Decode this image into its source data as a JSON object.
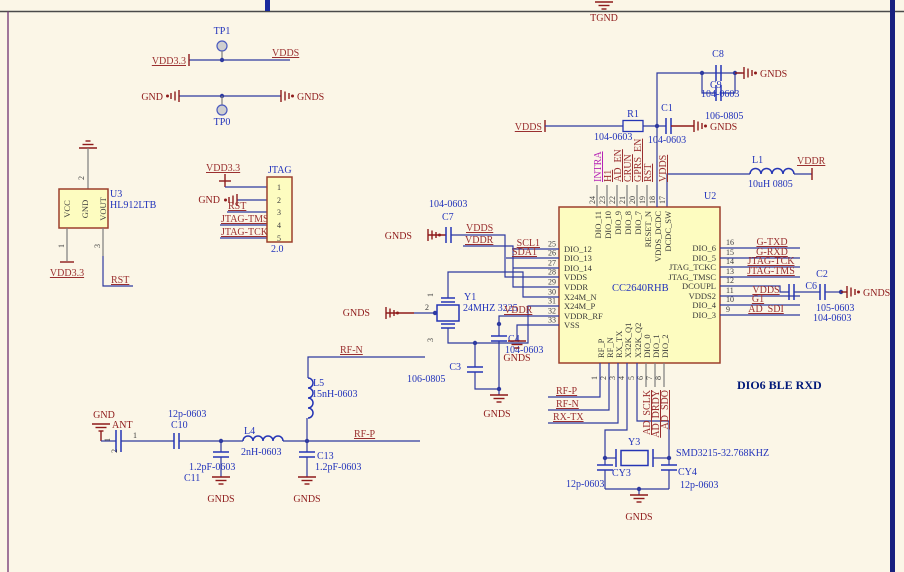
{
  "sheet": {
    "tgnd": "TGND"
  },
  "tp": {
    "tp1": "TP1",
    "tp0": "TP0",
    "vdd33": "VDD3.3",
    "vdds": "VDDS",
    "gnd": "GND",
    "gnds": "GNDS"
  },
  "u3": {
    "ref": "U3",
    "part": "HL912LTB",
    "vcc": "VCC",
    "gnd": "GND",
    "vout": "VOUT",
    "p1": "1",
    "p2": "2",
    "p3": "3",
    "vdd": "VDD3.3",
    "rst": "RST"
  },
  "jtag": {
    "title": "JTAG",
    "ver": "2.0",
    "p": [
      "1",
      "2",
      "3",
      "4",
      "5"
    ],
    "vdd": "VDD3.3",
    "gnd": "GND",
    "rst": "RST",
    "tms": "JTAG-TMS",
    "tck": "JTAG-TCK"
  },
  "vr": {
    "vdds": "VDDS",
    "r1": "R1",
    "r1val": "104-0603",
    "c1": "C1",
    "c1val": "104-0603",
    "gnds1": "GNDS",
    "c8": "C8",
    "c8val": "104-0603",
    "c9": "C9",
    "c9val": "106-0805",
    "gnds2": "GNDS",
    "l1": "L1",
    "l1val": "10uH 0805",
    "vddr": "VDDR"
  },
  "x24": {
    "c7": "C7",
    "c7val": "104-0603",
    "gnds_c7": "GNDS",
    "vdds": "VDDS",
    "vddr29": "VDDR",
    "y1": "Y1",
    "y1val": "24MHZ 3225",
    "gnds_y1": "GNDS",
    "p1": "1",
    "p2": "2",
    "p3": "3",
    "c4": "C4",
    "c4val": "104-0603",
    "c3": "C3",
    "c3val": "106-0805",
    "gnds33": "GNDS",
    "gnds_bot": "GNDS",
    "vddr32": "VDDR"
  },
  "u2": {
    "ref": "U2",
    "name": "CC2640RHB",
    "left": [
      {
        "num": "25",
        "name": "DIO_12",
        "net": "SCL1"
      },
      {
        "num": "26",
        "name": "DIO_13",
        "net": "SDA1"
      },
      {
        "num": "27",
        "name": "DIO_14"
      },
      {
        "num": "28",
        "name": "VDDS"
      },
      {
        "num": "29",
        "name": "VDDR"
      },
      {
        "num": "30",
        "name": "X24M_N"
      },
      {
        "num": "31",
        "name": "X24M_P"
      },
      {
        "num": "32",
        "name": "VDDR_RF"
      },
      {
        "num": "33",
        "name": "VSS"
      }
    ],
    "top": [
      {
        "num": "24",
        "name": "DIO_11",
        "net": "INTRA"
      },
      {
        "num": "23",
        "name": "DIO_10",
        "net": "H1"
      },
      {
        "num": "22",
        "name": "DIO_9",
        "net": "AD_EN"
      },
      {
        "num": "21",
        "name": "DIO_8",
        "net": "CRUN"
      },
      {
        "num": "20",
        "name": "DIO_7",
        "net": "GPRS_EN"
      },
      {
        "num": "19",
        "name": "RESET_N",
        "net": "RST"
      },
      {
        "num": "18",
        "name": "VDDS_DCDC",
        "net": "VDDS"
      },
      {
        "num": "17",
        "name": "DCDC_SW"
      }
    ],
    "right": [
      {
        "num": "16",
        "name": "DIO_6",
        "net": "G-TXD"
      },
      {
        "num": "15",
        "name": "DIO_5",
        "net": "G-RXD"
      },
      {
        "num": "14",
        "name": "JTAG_TCKC",
        "net": "JTAG-TCK"
      },
      {
        "num": "13",
        "name": "JTAG_TMSC",
        "net": "JTAG-TMS"
      },
      {
        "num": "12",
        "name": "DCOUPL"
      },
      {
        "num": "11",
        "name": "VDDS2",
        "net": "VDDS"
      },
      {
        "num": "10",
        "name": "DIO_4",
        "net": "G1"
      },
      {
        "num": "9",
        "name": "DIO_3",
        "net": "AD_SDI"
      }
    ],
    "bottom": [
      {
        "num": "1",
        "name": "RF_P"
      },
      {
        "num": "2",
        "name": "RF_N"
      },
      {
        "num": "3",
        "name": "RX_TX"
      },
      {
        "num": "4",
        "name": "X32K_Q1"
      },
      {
        "num": "5",
        "name": "X32K_Q2"
      },
      {
        "num": "6",
        "name": "DIO_0",
        "net": "AD_SCLK"
      },
      {
        "num": "7",
        "name": "DIO_1",
        "net": "AD_DRDY"
      },
      {
        "num": "8",
        "name": "DIO_2",
        "net": "AD_SDO"
      }
    ],
    "rfp": "RF-P",
    "rfn": "RF-N",
    "rxtx": "RX-TX"
  },
  "dc": {
    "c2": "C2",
    "c2val": "105-0603",
    "c6": "C6",
    "c6val": "104-0603",
    "gnds": "GNDS"
  },
  "y3": {
    "y3": "Y3",
    "y3val": "SMD3215-32.768KHZ",
    "cy3": "CY3",
    "cy3val": "12p-0603",
    "cy4": "CY4",
    "cy4val": "12p-0603",
    "gnds": "GNDS"
  },
  "ant": {
    "gnd": "GND",
    "name": "ANT",
    "p1": "1",
    "p2": "2",
    "w1": "1",
    "c10": "C10",
    "c10val": "12p-0603",
    "c11": "C11",
    "c11val": "1.2pF-0603",
    "gnds1": "GNDS",
    "l4": "L4",
    "l4val": "2nH-0603",
    "c13": "C13",
    "c13val": "1.2pF-0603",
    "gnds2": "GNDS",
    "l5": "L5",
    "l5val": "15nH-0603",
    "rfn": "RF-N",
    "rfp": "RF-P"
  },
  "note": "DIO6  BLE RXD"
}
